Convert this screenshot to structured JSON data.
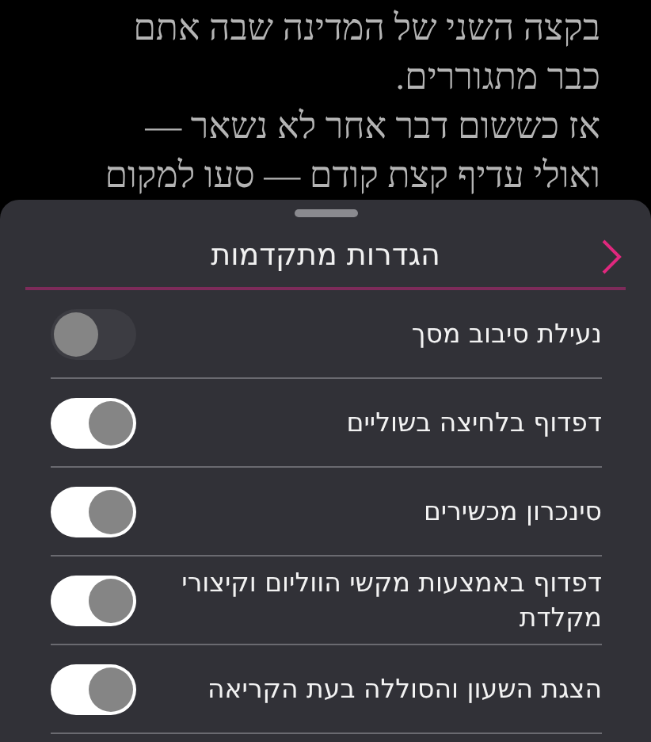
{
  "reading_text": {
    "lines": [
      "בקצה השני של המדינה שבה אתם",
      "כבר מתגוררים.",
      "אז כששום דבר אחר לא נשאר —",
      "ואולי עדיף קצת קודם — סעו למקום"
    ]
  },
  "sheet": {
    "title": "הגדרות מתקדמות",
    "settings": [
      {
        "label": "נעילת סיבוב מסך",
        "on": false
      },
      {
        "label": "דפדוף בלחיצה בשוליים",
        "on": true
      },
      {
        "label": "סינכרון מכשירים",
        "on": true
      },
      {
        "label": "דפדוף באמצעות מקשי הווליום וקיצורי מקלדת",
        "on": true
      },
      {
        "label": "הצגת השעון והסוללה בעת הקריאה",
        "on": true
      }
    ]
  }
}
